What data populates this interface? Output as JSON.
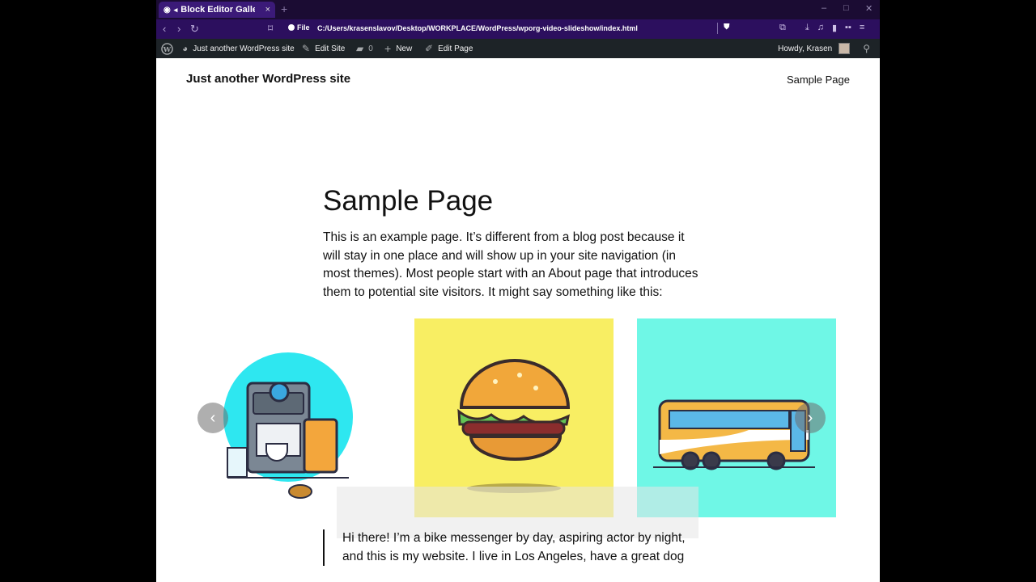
{
  "browser": {
    "tab_title": "Block Editor Gallery",
    "tab_close": "×",
    "new_tab": "+",
    "file_label": "File",
    "url": "C:/Users/krasenslavov/Desktop/WORKPLACE/WordPress/wporg-video-slideshow/index.html"
  },
  "adminbar": {
    "site_name": "Just another WordPress site",
    "edit_site": "Edit Site",
    "comments_count": "0",
    "new_label": "New",
    "edit_page": "Edit Page",
    "howdy": "Howdy, Krasen"
  },
  "site": {
    "title": "Just another WordPress site",
    "nav": [
      "Sample Page"
    ]
  },
  "page": {
    "title": "Sample Page",
    "intro": "This is an example page. It’s different from a blog post because it will stay in one place and will show up in your site navigation (in most themes). Most people start with an About page that introduces them to potential site visitors. It might say something like this:",
    "quote": "Hi there! I’m a bike messenger by day, aspiring actor by night, and this is my website. I live in Los Angeles, have a great dog"
  },
  "gallery": {
    "slides": [
      {
        "name": "coffee-machine-illustration",
        "bg": "#ffffff"
      },
      {
        "name": "burger-illustration",
        "bg": "#f8ee63"
      },
      {
        "name": "bus-illustration",
        "bg": "#6ff7e6"
      }
    ],
    "prev_arrow": "‹",
    "next_arrow": "›"
  },
  "colors": {
    "tab_bg": "#3b1a78",
    "toolbar_bg": "#2c0f5e",
    "adminbar_bg": "#1d2327"
  }
}
